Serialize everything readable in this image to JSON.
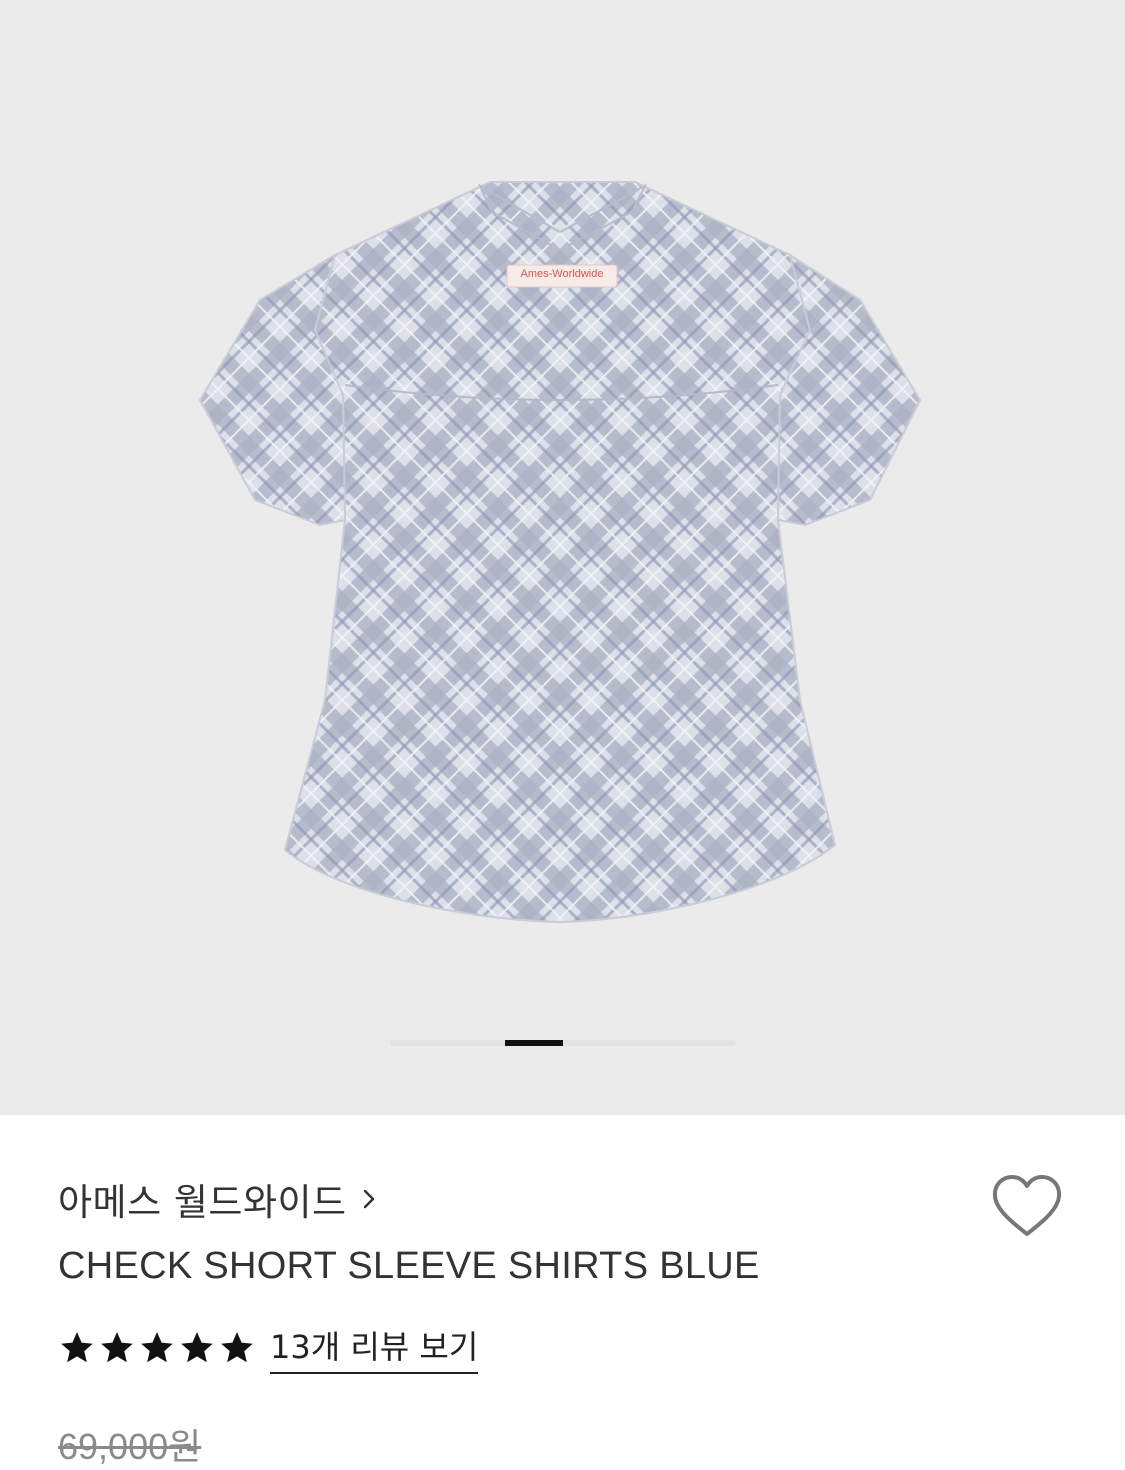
{
  "gallery": {
    "image_alt": "check short sleeve shirt back view",
    "label_text": "Ames-Worldwide",
    "current_slide": 2,
    "colors": {
      "background": "#ebebeb",
      "shirt_light": "#d9dce6",
      "shirt_dark": "#9aa1b8",
      "label_text": "#d8554e"
    }
  },
  "product": {
    "brand": "아메스 월드와이드",
    "title": "CHECK SHORT SLEEVE SHIRTS BLUE",
    "rating_stars": 5,
    "review_link": "13개 리뷰 보기",
    "original_price": "69,000원"
  },
  "icons": {
    "brand_chevron": "chevron-right-icon",
    "wishlist": "heart-outline-icon",
    "star": "star-filled-icon"
  }
}
